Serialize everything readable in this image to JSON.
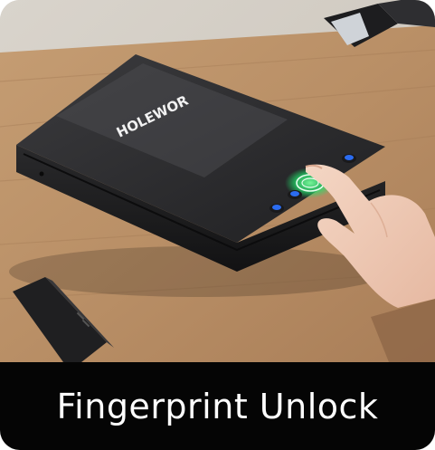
{
  "product": {
    "brand_label": "HOLEWOR",
    "image_description_icon": "fingerprint-safe-photo"
  },
  "caption": {
    "text": "Fingerprint Unlock"
  },
  "colors": {
    "caption_bg": "#050505",
    "caption_text": "#ffffff",
    "sensor_glow": "#22e06b",
    "button_blue": "#2b6cf0",
    "case_body": "#2b2b2d",
    "table_wood": "#b88f67"
  }
}
